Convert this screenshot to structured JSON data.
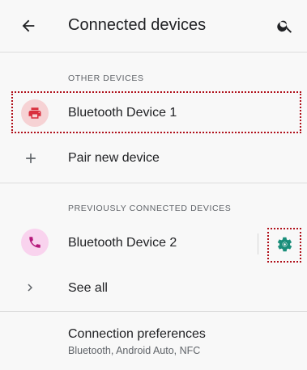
{
  "header": {
    "title": "Connected devices"
  },
  "sections": {
    "other_devices": "OTHER DEVICES",
    "previously_connected": "PREVIOUSLY CONNECTED DEVICES"
  },
  "devices": {
    "device1": {
      "name": "Bluetooth Device 1",
      "icon": "printer-icon",
      "icon_color": "#d9303e",
      "icon_bg": "#f6d2d4"
    },
    "pair_new": {
      "label": "Pair new device",
      "icon": "plus-icon"
    },
    "device2": {
      "name": "Bluetooth Device 2",
      "icon": "phone-icon",
      "icon_color": "#b5197b",
      "icon_bg": "#f9d3ee",
      "settings_icon": "gear-icon",
      "settings_color": "#1a8e7a"
    },
    "see_all": {
      "label": "See all",
      "icon": "chevron-right-icon"
    }
  },
  "connection_preferences": {
    "title": "Connection preferences",
    "subtitle": "Bluetooth, Android Auto, NFC"
  },
  "annotation": {
    "highlight_color": "#b0101a"
  }
}
